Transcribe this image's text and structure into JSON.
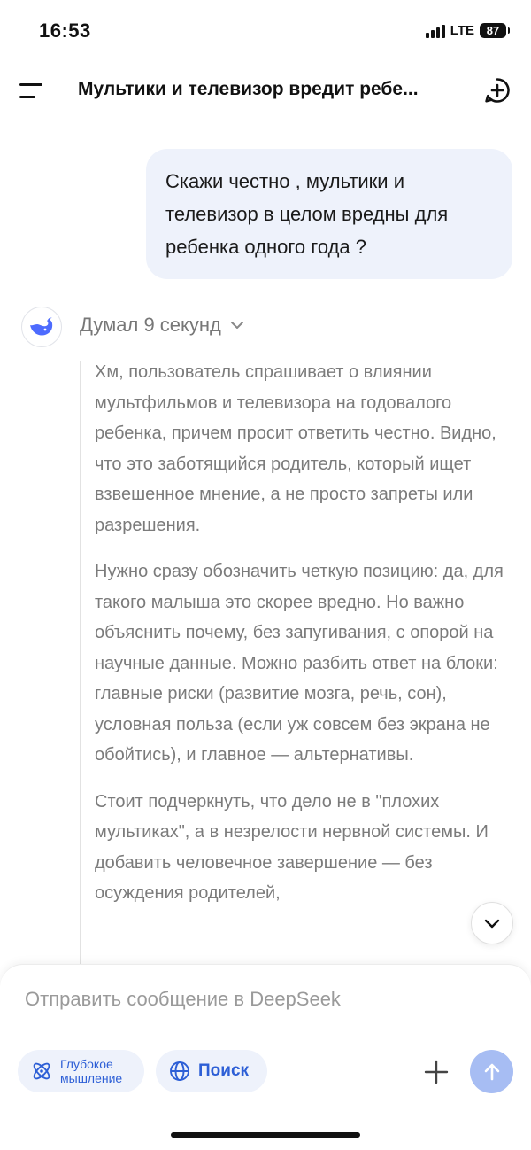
{
  "status": {
    "time": "16:53",
    "network": "LTE",
    "battery": "87"
  },
  "header": {
    "title": "Мультики и телевизор вредит ребе...",
    "menu_icon": "menu-icon",
    "new_chat_icon": "new-chat-icon"
  },
  "conversation": {
    "user_message": "Скажи честно , мультики и телевизор в целом вредны для ребенка одного года ?",
    "assistant": {
      "avatar_icon": "deepseek-whale-icon",
      "thought_label": "Думал 9 секунд",
      "thought_paragraphs": [
        "Хм, пользователь спрашивает о влиянии мультфильмов и телевизора на годовалого ребенка, причем просит ответить честно. Видно, что это заботящийся родитель, который ищет взвешенное мнение, а не просто запреты или разрешения.",
        "Нужно сразу обозначить четкую позицию: да, для такого малыша это скорее вредно. Но важно объяснить почему, без запугивания, с опорой на научные данные. Можно разбить ответ на блоки: главные риски (развитие мозга, речь, сон), условная польза (если уж совсем без экрана не обойтись), и главное — альтернативы.",
        "Стоит подчеркнуть, что дело не в \"плохих мультиках\", а в незрелости нервной системы. И добавить человечное завершение — без осуждения родителей,"
      ]
    }
  },
  "composer": {
    "placeholder": "Отправить сообщение в DeepSeek",
    "deep_think_line1": "Глубокое",
    "deep_think_line2": "мышление",
    "search_label": "Поиск"
  },
  "colors": {
    "accent": "#2d5fd6",
    "bubble": "#eef2fb",
    "send_disabled": "#a7bdf3"
  }
}
